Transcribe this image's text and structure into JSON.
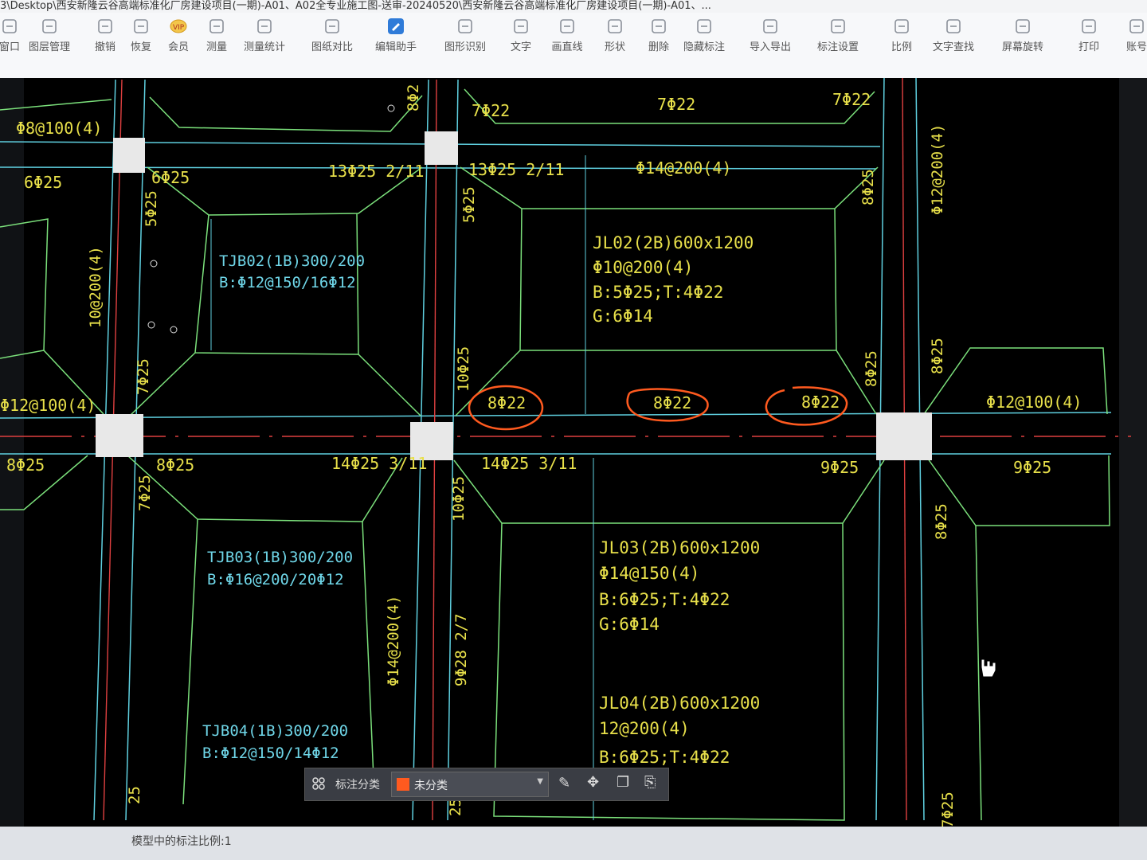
{
  "window": {
    "title": "3\\Desktop\\西安新隆云谷高端标准化厂房建设项目(一期)-A01、A02全专业施工图-送审-20240520\\西安新隆云谷高端标准化厂房建设项目(一期)-A01、..."
  },
  "toolbar": {
    "items": [
      {
        "label": "窗口",
        "icon": "window-icon"
      },
      {
        "label": "图层管理",
        "icon": "layers-icon"
      },
      {
        "label": "撤销",
        "icon": "undo-icon"
      },
      {
        "label": "恢复",
        "icon": "redo-icon"
      },
      {
        "label": "会员",
        "icon": "vip-icon"
      },
      {
        "label": "测量",
        "icon": "ruler-icon"
      },
      {
        "label": "测量统计",
        "icon": "measure-stats-icon"
      },
      {
        "label": "图纸对比",
        "icon": "compare-icon"
      },
      {
        "label": "编辑助手",
        "icon": "edit-assistant-icon"
      },
      {
        "label": "图形识别",
        "icon": "shape-recognize-icon"
      },
      {
        "label": "文字",
        "icon": "text-icon"
      },
      {
        "label": "画直线",
        "icon": "line-icon"
      },
      {
        "label": "形状",
        "icon": "shape-icon"
      },
      {
        "label": "删除",
        "icon": "eraser-icon"
      },
      {
        "label": "隐藏标注",
        "icon": "hide-icon"
      },
      {
        "label": "导入导出",
        "icon": "import-export-icon"
      },
      {
        "label": "标注设置",
        "icon": "annotation-settings-icon"
      },
      {
        "label": "比例",
        "icon": "scale-icon"
      },
      {
        "label": "文字查找",
        "icon": "text-search-icon"
      },
      {
        "label": "屏幕旋转",
        "icon": "rotate-screen-icon"
      },
      {
        "label": "打印",
        "icon": "print-icon"
      },
      {
        "label": "账号",
        "icon": "account-icon"
      }
    ]
  },
  "drawing": {
    "labels": {
      "top_left_stirrup": "Φ8@100(4)",
      "l_6c25": "6Φ25",
      "l_6c25b": "6Φ25",
      "l_13c25_a": "13Φ25 2/11",
      "l_13c25_b": "13Φ25 2/11",
      "l_7c22_a": "7Φ22",
      "l_7c22_b": "7Φ22",
      "l_7c22_c": "7Φ22",
      "l_c14_200": "Φ14@200(4)",
      "l_5c25_a": "5Φ25",
      "l_5c25_b": "5Φ25",
      "l_8c25_r1": "8Φ25",
      "l_c12_200_r": "Φ12@200(4)",
      "l_10_200": "10@200(4)",
      "l_7c25": "7Φ25",
      "l_12_100": "Φ12@100(4)",
      "l_10c25_a": "10Φ25",
      "l_8c22_1": "8Φ22",
      "l_8c22_2": "8Φ22",
      "l_8c22_3": "8Φ22",
      "l_8c25_r2": "8Φ25",
      "l_8c25_r3": "8Φ25",
      "l_c12_100_r": "Φ12@100(4)",
      "l_8c25_left": "8Φ25",
      "l_8c25_left2": "8Φ25",
      "l_14c25_a": "14Φ25 3/11",
      "l_14c25_b": "14Φ25 3/11",
      "l_9c25_a": "9Φ25",
      "l_9c25_b": "9Φ25",
      "l_7c25_b": "7Φ25",
      "l_10c25_b": "10Φ25",
      "l_8c25_r4": "8Φ25",
      "l_c14_200_v": "Φ14@200(4)",
      "l_9c28": "9Φ28 2/7",
      "l_8_top": "8Φ2",
      "l_7c25_bottom": "7Φ25",
      "l_25_bottom": "25",
      "l_25_bottom2": "25"
    },
    "beams": {
      "jl02": [
        "JL02(2B)600x1200",
        "Φ10@200(4)",
        "B:5Φ25;T:4Φ22",
        "G:6Φ14"
      ],
      "jl03": [
        "JL03(2B)600x1200",
        "Φ14@150(4)",
        "B:6Φ25;T:4Φ22",
        "G:6Φ14"
      ],
      "jl04": [
        "JL04(2B)600x1200",
        "12@200(4)",
        "B:6Φ25;T:4Φ22"
      ]
    },
    "slabs": {
      "tjb02": [
        "TJB02(1B)300/200",
        "B:Φ12@150/16Φ12"
      ],
      "tjb03": [
        "TJB03(1B)300/200",
        "B:Φ16@200/20Φ12"
      ],
      "tjb04": [
        "TJB04(1B)300/200",
        "B:Φ12@150/14Φ12"
      ]
    }
  },
  "annotation_bar": {
    "label": "标注分类",
    "selected": "未分类",
    "selected_color": "#ff5a1f"
  },
  "status": {
    "scale_text": "模型中的标注比例:1"
  },
  "colors": {
    "background": "#000000",
    "text_yellow": "#e8e04a",
    "text_cyan": "#6fd6e8",
    "line_green": "#7be07b",
    "line_cyan": "#5fd0e0",
    "axis_red": "#e04040",
    "highlight": "#ff5a1f"
  }
}
